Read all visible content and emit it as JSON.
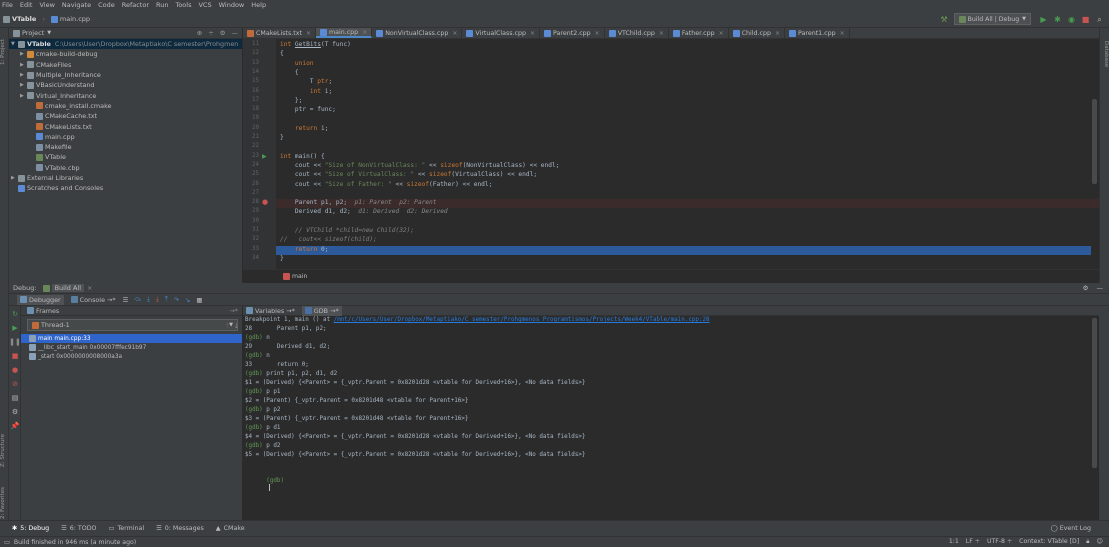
{
  "colors": {
    "accent": "#4a88c7",
    "selection": "#2f65ca",
    "breakpoint": "#c75450",
    "run_green": "#499c54",
    "stop_red": "#c75450"
  },
  "menu": [
    "File",
    "Edit",
    "View",
    "Navigate",
    "Code",
    "Refactor",
    "Run",
    "Tools",
    "VCS",
    "Window",
    "Help"
  ],
  "breadcrumbs": {
    "project": "VTable",
    "file": "main.cpp"
  },
  "toolbar": {
    "run_config": "Build All | Debug",
    "run_config_arrow": "▼",
    "hammer_icon": "hammer-icon",
    "run_icon": "play-icon",
    "debug_icon": "bug-icon",
    "stop_icon": "stop-icon",
    "search_icon": "search-icon"
  },
  "left_tabs": {
    "project": "1: Project",
    "structure": "Z: Structure",
    "favorites": "2: Favorites"
  },
  "right_tabs": {
    "database": "Database"
  },
  "project_panel": {
    "title": "Project",
    "dropdown_arrow": "▼",
    "icons": [
      "⊕",
      "÷",
      "⚙",
      "—"
    ],
    "root_label": "VTable",
    "root_path": "C:\\Users\\User\\Dropbox\\Metaptiakо\\C semester\\Prohgmen",
    "items": [
      {
        "label": "cmake-build-debug",
        "type": "folder-orange",
        "arrow": "▶",
        "indent": 1
      },
      {
        "label": "CMakeFiles",
        "type": "folder",
        "arrow": "▶",
        "indent": 1
      },
      {
        "label": "Multiple_Inheritance",
        "type": "folder",
        "arrow": "▶",
        "indent": 1
      },
      {
        "label": "VBasicUnderstand",
        "type": "folder",
        "arrow": "▶",
        "indent": 1
      },
      {
        "label": "Virtual_Inheritance",
        "type": "folder",
        "arrow": "▶",
        "indent": 1
      },
      {
        "label": "cmake_install.cmake",
        "type": "cmake",
        "arrow": "",
        "indent": 2
      },
      {
        "label": "CMakeCache.txt",
        "type": "txt",
        "arrow": "",
        "indent": 2
      },
      {
        "label": "CMakeLists.txt",
        "type": "cmake",
        "arrow": "",
        "indent": 2
      },
      {
        "label": "main.cpp",
        "type": "cpp",
        "arrow": "",
        "indent": 2
      },
      {
        "label": "Makefile",
        "type": "txt",
        "arrow": "",
        "indent": 2
      },
      {
        "label": "VTable",
        "type": "exe",
        "arrow": "",
        "indent": 2
      },
      {
        "label": "VTable.cbp",
        "type": "txt",
        "arrow": "",
        "indent": 2
      },
      {
        "label": "External Libraries",
        "type": "lib",
        "arrow": "▶",
        "indent": 0
      },
      {
        "label": "Scratches and Consoles",
        "type": "scratch",
        "arrow": "",
        "indent": 0
      }
    ]
  },
  "editor_tabs": [
    {
      "label": "CMakeLists.txt",
      "type": "cmake",
      "active": false
    },
    {
      "label": "main.cpp",
      "type": "cpp",
      "active": true
    },
    {
      "label": "NonVirtualClass.cpp",
      "type": "cpp",
      "active": false
    },
    {
      "label": "VirtualClass.cpp",
      "type": "cpp",
      "active": false
    },
    {
      "label": "Parent2.cpp",
      "type": "cpp",
      "active": false
    },
    {
      "label": "VTChild.cpp",
      "type": "cpp",
      "active": false
    },
    {
      "label": "Father.cpp",
      "type": "cpp",
      "active": false
    },
    {
      "label": "Child.cpp",
      "type": "cpp",
      "active": false
    },
    {
      "label": "Parent1.cpp",
      "type": "cpp",
      "active": false
    }
  ],
  "code_lines": [
    {
      "n": "11",
      "html": "<span class='kw'>int</span> <span style='text-decoration:underline'>GetBits</span>(T func)"
    },
    {
      "n": "12",
      "html": "{"
    },
    {
      "n": "13",
      "html": "    <span class='kw'>union</span>"
    },
    {
      "n": "14",
      "html": "    {"
    },
    {
      "n": "15",
      "html": "        T <span class='kw'>ptr</span>;"
    },
    {
      "n": "16",
      "html": "        <span class='kw'>int</span> i;"
    },
    {
      "n": "17",
      "html": "    };"
    },
    {
      "n": "18",
      "html": "    ptr = func;"
    },
    {
      "n": "19",
      "html": ""
    },
    {
      "n": "20",
      "html": "    <span class='kw'>return</span> i;"
    },
    {
      "n": "21",
      "html": "}"
    },
    {
      "n": "22",
      "html": ""
    },
    {
      "n": "23",
      "html": "<span class='kw'>int</span> main() {"
    },
    {
      "n": "24",
      "html": "    cout &lt;&lt; <span class='str'>\"Size of NonVirtualClass: \"</span> &lt;&lt; <span class='kw'>sizeof</span>(NonVirtualClass) &lt;&lt; endl;"
    },
    {
      "n": "25",
      "html": "    cout &lt;&lt; <span class='str'>\"Size of VirtualClass: \"</span> &lt;&lt; <span class='kw'>sizeof</span>(VirtualClass) &lt;&lt; endl;"
    },
    {
      "n": "26",
      "html": "    cout &lt;&lt; <span class='str'>\"Size of Father: \"</span> &lt;&lt; <span class='kw'>sizeof</span>(Father) &lt;&lt; endl;"
    },
    {
      "n": "27",
      "html": ""
    },
    {
      "n": "28",
      "html": "    Parent p1, p2;  <span class='inl'>p1: Parent  p2: Parent</span>"
    },
    {
      "n": "29",
      "html": "    Derived d1, d2;  <span class='inl'>d1: Derived  d2: Derived</span>"
    },
    {
      "n": "30",
      "html": ""
    },
    {
      "n": "31",
      "html": "    <span class='cmt'>// VTChild *child=new Child(32);</span>"
    },
    {
      "n": "32",
      "html": "<span class='cmt'>//   cout&lt;&lt; sizeof(child);</span>"
    },
    {
      "n": "33",
      "html": "    <span class='kw'>return</span> 0;"
    },
    {
      "n": "34",
      "html": "}"
    }
  ],
  "editor_breadcrumb": "main",
  "debug": {
    "title": "Debug:",
    "config": "Build All",
    "tabs": {
      "debugger": "Debugger",
      "console": "Console →*"
    },
    "frames_title": "Frames",
    "thread": "Thread-1",
    "frames": [
      {
        "label": "main main.cpp:33",
        "selected": true
      },
      {
        "label": "__libc_start_main 0x00007fffec91b97",
        "selected": false
      },
      {
        "label": "_start 0x0000000008000a3a",
        "selected": false
      }
    ],
    "variables_tab": "Variables →*",
    "gdb_tab": "GDB →*",
    "gdb_lines": [
      {
        "prompt": "",
        "text": "Breakpoint 1, main () at ",
        "link": "/mnt/c/Users/User/Dropbox/Metaptiakо/C semester/Prohgmenos Programtismos/Projects/Week4/VTable/main.cpp:28"
      },
      {
        "prompt": "",
        "text": "28       Parent p1, p2;",
        "link": ""
      },
      {
        "prompt": "(gdb) ",
        "text": "n",
        "link": ""
      },
      {
        "prompt": "",
        "text": "29       Derived d1, d2;",
        "link": ""
      },
      {
        "prompt": "(gdb) ",
        "text": "n",
        "link": ""
      },
      {
        "prompt": "",
        "text": "33       return 0;",
        "link": ""
      },
      {
        "prompt": "(gdb) ",
        "text": "print p1, p2, d1, d2",
        "link": ""
      },
      {
        "prompt": "",
        "text": "$1 = (Derived) {<Parent> = {_vptr.Parent = 0x8201d28 <vtable for Derived+16>}, <No data fields>}",
        "link": ""
      },
      {
        "prompt": "(gdb) ",
        "text": "p p1",
        "link": ""
      },
      {
        "prompt": "",
        "text": "$2 = (Parent) {_vptr.Parent = 0x8201d48 <vtable for Parent+16>}",
        "link": ""
      },
      {
        "prompt": "(gdb) ",
        "text": "p p2",
        "link": ""
      },
      {
        "prompt": "",
        "text": "$3 = (Parent) {_vptr.Parent = 0x8201d48 <vtable for Parent+16>}",
        "link": ""
      },
      {
        "prompt": "(gdb) ",
        "text": "p d1",
        "link": ""
      },
      {
        "prompt": "",
        "text": "$4 = (Derived) {<Parent> = {_vptr.Parent = 0x8201d28 <vtable for Derived+16>}, <No data fields>}",
        "link": ""
      },
      {
        "prompt": "(gdb) ",
        "text": "p d2",
        "link": ""
      },
      {
        "prompt": "",
        "text": "$5 = (Derived) {<Parent> = {_vptr.Parent = 0x8201d28 <vtable for Derived+16>}, <No data fields>}",
        "link": ""
      }
    ],
    "gdb_input_prompt": "(gdb)"
  },
  "bottom_tabs": [
    {
      "label": "5: Debug",
      "active": true
    },
    {
      "label": "6: TODO",
      "active": false
    },
    {
      "label": "Terminal",
      "active": false
    },
    {
      "label": "0: Messages",
      "active": false
    },
    {
      "label": "CMake",
      "active": false
    }
  ],
  "event_log": "Event Log",
  "status": {
    "message": "Build finished in 946 ms (a minute ago)",
    "position": "1:1",
    "line_sep": "LF ÷",
    "encoding": "UTF-8 ÷",
    "context": "Context: VTable [D]"
  }
}
